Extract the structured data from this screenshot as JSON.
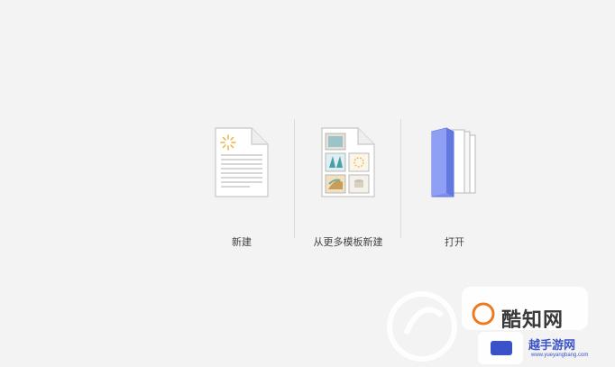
{
  "options": [
    {
      "label": "新建",
      "icon": "new-document-icon"
    },
    {
      "label": "从更多模板新建",
      "icon": "template-document-icon"
    },
    {
      "label": "打开",
      "icon": "open-folder-icon"
    }
  ],
  "watermark": {
    "brand1": "酷知网",
    "brand2": "越手游网",
    "url": "www.yueyangbang.com"
  },
  "colors": {
    "background": "#f3f3f3",
    "folder_blue": "#7b8ff0",
    "divider": "#dcdcdc"
  }
}
